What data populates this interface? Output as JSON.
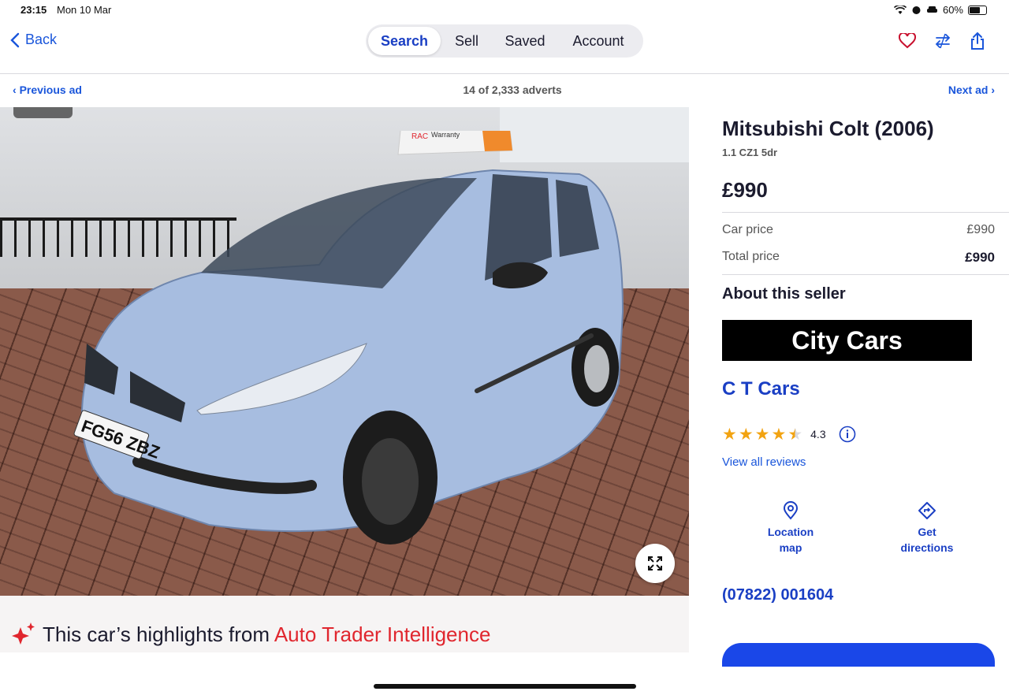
{
  "status": {
    "time": "23:15",
    "date": "Mon 10 Mar",
    "battery": "60%",
    "battery_level": 0.6
  },
  "nav": {
    "back_label": "Back",
    "tabs": [
      {
        "label": "Search",
        "active": true
      },
      {
        "label": "Sell",
        "active": false
      },
      {
        "label": "Saved",
        "active": false
      },
      {
        "label": "Account",
        "active": false
      }
    ],
    "icons": [
      "heart-icon",
      "compare-icon",
      "share-icon"
    ]
  },
  "subnav": {
    "previous_label": "Previous ad",
    "count": "14 of 2,333 adverts",
    "next_label": "Next ad"
  },
  "gallery": {
    "dot_count": 9,
    "active_dot": 0,
    "plate": "FG56 ZBZ",
    "roof_sign": "Warranty",
    "roof_logo": "RAC"
  },
  "highlights": {
    "prefix": "This car’s highlights from ",
    "brand": "Auto Trader Intelligence"
  },
  "listing": {
    "title": "Mitsubishi Colt (2006)",
    "subtitle": "1.1 CZ1 5dr",
    "price": "£990",
    "car_price_label": "Car price",
    "car_price_value": "£990",
    "total_price_label": "Total price",
    "total_price_value": "£990"
  },
  "seller": {
    "heading": "About this seller",
    "logo_text": "City Cars",
    "name": "C T Cars",
    "rating": "4.3",
    "rating_value": 4.3,
    "reviews_link": "View all reviews",
    "location_line1": "Location",
    "location_line2": "map",
    "directions_line1": "Get",
    "directions_line2": "directions",
    "phone": "(07822) 001604"
  },
  "colors": {
    "accent": "#1a3fc4",
    "link": "#1a56db",
    "brand_red": "#e0262e",
    "star": "#f2a311"
  }
}
